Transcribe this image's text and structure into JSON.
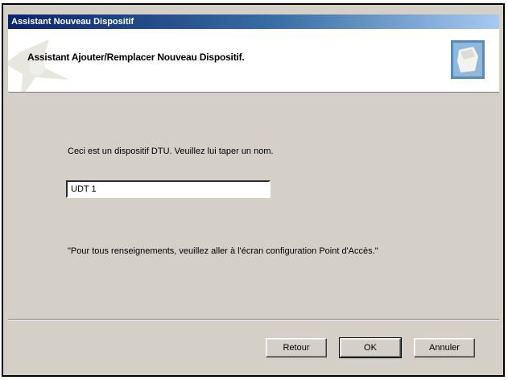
{
  "window": {
    "title": "Assistant Nouveau Dispositif"
  },
  "header": {
    "title": "Assistant Ajouter/Remplacer Nouveau Dispositif.",
    "icon": "device-icon"
  },
  "content": {
    "prompt": "Ceci est un dispositif DTU. Veuillez lui taper un nom.",
    "name_value": "UDT 1",
    "note": "\"Pour tous renseignements, veuillez aller à l'écran configuration Point d'Accès.\""
  },
  "buttons": {
    "back_label": "Retour",
    "ok_label": "OK",
    "cancel_label": "Annuler"
  }
}
